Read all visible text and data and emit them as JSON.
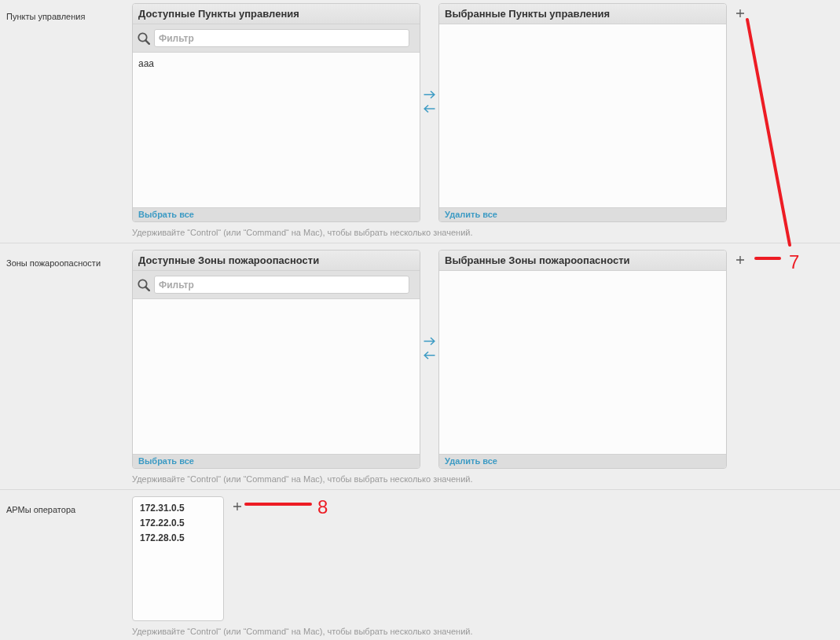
{
  "fields": [
    {
      "kind": "selector",
      "label": "Пункты управления",
      "available": {
        "title": "Доступные Пункты управления",
        "filter": {
          "placeholder": "Фильтр"
        },
        "options": [
          "aaa"
        ],
        "action": "Выбрать все"
      },
      "chosen": {
        "title": "Выбранные Пункты управления",
        "action": "Удалить все"
      },
      "help": "Удерживайте “Control“ (или “Command“ на Mac), чтобы выбрать несколько значений."
    },
    {
      "kind": "selector",
      "label": "Зоны пожароопасности",
      "available": {
        "title": "Доступные Зоны пожароопасности",
        "filter": {
          "placeholder": "Фильтр"
        },
        "action": "Выбрать все"
      },
      "chosen": {
        "title": "Выбранные Зоны пожароопасности",
        "action": "Удалить все"
      },
      "help": "Удерживайте “Control“ (или “Command“ на Mac), чтобы выбрать несколько значений."
    },
    {
      "kind": "multiselect",
      "label": "АРМы оператора",
      "options": [
        "172.31.0.5",
        "172.22.0.5",
        "172.28.0.5"
      ],
      "help": "Удерживайте “Control“ (или “Command“ на Mac), чтобы выбрать несколько значений."
    }
  ],
  "annotations": [
    {
      "label": "7"
    },
    {
      "label": "8"
    }
  ]
}
